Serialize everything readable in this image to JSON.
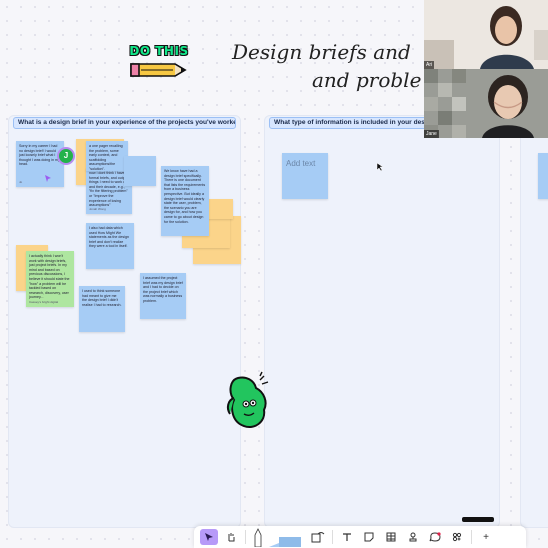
{
  "board": {
    "title_line1": "Design briefs and",
    "title_line2": "and proble",
    "sticker_text": "DO THIS"
  },
  "columns": [
    {
      "header": "What is a design brief in your experience of the projects you've worked o..."
    },
    {
      "header": "What type of information is included in your design b"
    }
  ],
  "stickies": [
    {
      "color": "blue",
      "text": "Sorry in my career I had no design brief! I would just loosely brief what I thought I was doing in my head.",
      "author": "Jo"
    },
    {
      "color": "yellow",
      "text": "",
      "author": ""
    },
    {
      "color": "blue",
      "text": "a one pager recalling the problem, some early context, and scaffolding assumptions/the \"solution\".",
      "author": ""
    },
    {
      "color": "blue",
      "text": "",
      "author": ""
    },
    {
      "color": "blue",
      "text": "now i dont think i have formal briefs, and output things I need to work on and their decade, e.g., \"fix the filtering problem\" or \"Improve the experience of losing assumptions\"",
      "author": "Jonah Wong"
    },
    {
      "color": "blue",
      "text": "We know have had a design brief specifically. There is one document that lists the requirements from a business perspective. But ideally a design brief would clearly state the user, problem, the scenario you are design for, and how you came to go about design for the solution.",
      "author": ""
    },
    {
      "color": "yellow",
      "text": "",
      "author": ""
    },
    {
      "color": "yellow",
      "text": "",
      "author": ""
    },
    {
      "color": "blue",
      "text": "I also had data which used How Might We statements as the design brief and don't realize they were a tool in itself.",
      "author": ""
    },
    {
      "color": "yellow",
      "text": "",
      "author": ""
    },
    {
      "color": "green",
      "text": "I actually think I won't work with design briefs, just project briefs. In my mind and based on previous discussions, I believe it should state the \"how\" a problem will be tackled based on research, discovery, user journey...",
      "author": "Cassey's bright digital"
    },
    {
      "color": "blue",
      "text": "I assumed the project brief was my design brief and I had to decide on the project brief which was normally a business problem.",
      "author": ""
    },
    {
      "color": "blue",
      "text": "I used to think someone had meant to give me the design brief I didn't realise I had to research.",
      "author": ""
    }
  ],
  "placeholder": {
    "text": "Add text"
  },
  "collaborator": {
    "initial": "J"
  },
  "video": [
    {
      "name": "Ari"
    },
    {
      "name": "Jane"
    }
  ],
  "toolbar": {
    "items": [
      "select-tool",
      "hand-tool",
      "pen-tool",
      "shape-tool",
      "text-tool",
      "sticky-tool",
      "table-tool",
      "stamp-tool",
      "comment-tool",
      "more-tool",
      "add-tool"
    ],
    "add_label": "+"
  },
  "colors": {
    "sticky_blue": "#a6ccf5",
    "sticky_yellow": "#fbd48a",
    "sticky_green": "#aee6a0",
    "header_bg": "#d7e6ff",
    "accent_purple": "#b79af8",
    "mascot_green": "#22c55e"
  }
}
